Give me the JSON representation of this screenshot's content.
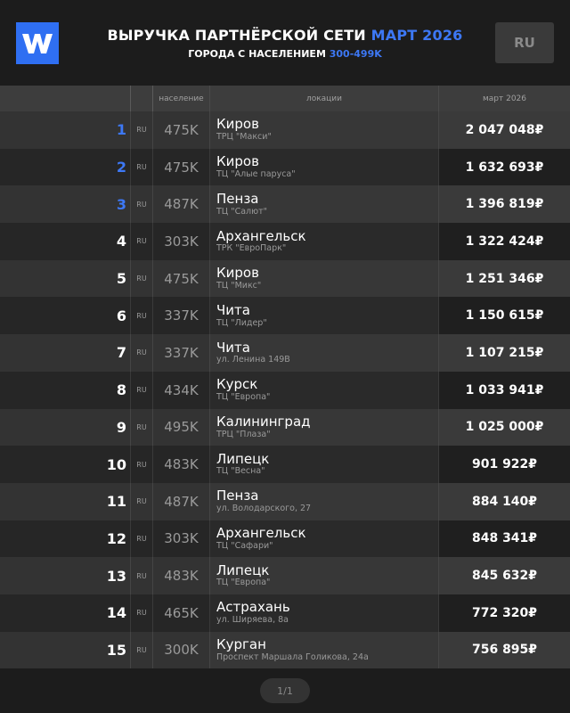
{
  "header": {
    "logo_icon": "w-logo-icon",
    "title_main": "ВЫРУЧКА ПАРТНЁРСКОЙ СЕТИ ",
    "title_accent": "МАРТ 2026",
    "subtitle_main": "ГОРОДА С НАСЕЛЕНИЕМ ",
    "subtitle_accent": "300-499K",
    "lang_button": "RU",
    "accent_color": "#3d78f5"
  },
  "table": {
    "columns": {
      "population": "население",
      "locations": "локации",
      "month": "март 2026"
    },
    "rows": [
      {
        "rank": "1",
        "cc": "RU",
        "pop": "475K",
        "city": "Киров",
        "venue": "ТРЦ \"Макси\"",
        "rev": "2 047 048₽"
      },
      {
        "rank": "2",
        "cc": "RU",
        "pop": "475K",
        "city": "Киров",
        "venue": "ТЦ \"Алые паруса\"",
        "rev": "1 632 693₽"
      },
      {
        "rank": "3",
        "cc": "RU",
        "pop": "487K",
        "city": "Пенза",
        "venue": "ТЦ \"Салют\"",
        "rev": "1 396 819₽"
      },
      {
        "rank": "4",
        "cc": "RU",
        "pop": "303K",
        "city": "Архангельск",
        "venue": "ТРК \"ЕвроПарк\"",
        "rev": "1 322 424₽"
      },
      {
        "rank": "5",
        "cc": "RU",
        "pop": "475K",
        "city": "Киров",
        "venue": "ТЦ \"Микс\"",
        "rev": "1 251 346₽"
      },
      {
        "rank": "6",
        "cc": "RU",
        "pop": "337K",
        "city": "Чита",
        "venue": "ТЦ \"Лидер\"",
        "rev": "1 150 615₽"
      },
      {
        "rank": "7",
        "cc": "RU",
        "pop": "337K",
        "city": "Чита",
        "venue": "ул. Ленина 149В",
        "rev": "1 107 215₽"
      },
      {
        "rank": "8",
        "cc": "RU",
        "pop": "434K",
        "city": "Курск",
        "venue": "ТЦ \"Европа\"",
        "rev": "1 033 941₽"
      },
      {
        "rank": "9",
        "cc": "RU",
        "pop": "495K",
        "city": "Калининград",
        "venue": "ТРЦ \"Плаза\"",
        "rev": "1 025 000₽"
      },
      {
        "rank": "10",
        "cc": "RU",
        "pop": "483K",
        "city": "Липецк",
        "venue": "ТЦ \"Весна\"",
        "rev": "901 922₽"
      },
      {
        "rank": "11",
        "cc": "RU",
        "pop": "487K",
        "city": "Пенза",
        "venue": "ул. Володарского, 27",
        "rev": "884 140₽"
      },
      {
        "rank": "12",
        "cc": "RU",
        "pop": "303K",
        "city": "Архангельск",
        "venue": "ТЦ \"Сафари\"",
        "rev": "848 341₽"
      },
      {
        "rank": "13",
        "cc": "RU",
        "pop": "483K",
        "city": "Липецк",
        "venue": "ТЦ \"Европа\"",
        "rev": "845 632₽"
      },
      {
        "rank": "14",
        "cc": "RU",
        "pop": "465K",
        "city": "Астрахань",
        "venue": "ул. Ширяева, 8а",
        "rev": "772 320₽"
      },
      {
        "rank": "15",
        "cc": "RU",
        "pop": "300K",
        "city": "Курган",
        "venue": "Проспект Маршала Голикова, 24а",
        "rev": "756 895₽"
      }
    ]
  },
  "pager": {
    "label": "1/1"
  }
}
